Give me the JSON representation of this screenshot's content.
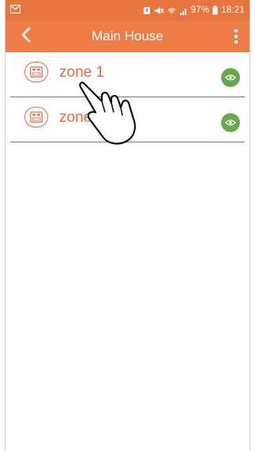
{
  "status_bar": {
    "battery": "97%",
    "time": "18:21",
    "icons": [
      "mail-icon",
      "alarm-icon",
      "mute-icon",
      "wifi-icon",
      "signal-icon",
      "battery-icon"
    ]
  },
  "header": {
    "title": "Main House",
    "back_icon": "chevron-left-icon",
    "menu_icon": "overflow-menu-icon"
  },
  "zones": [
    {
      "label": "zone 1",
      "icon": "thermostat-icon",
      "action_icon": "eye-icon"
    },
    {
      "label": "zone",
      "icon": "thermostat-icon",
      "action_icon": "eye-icon"
    }
  ],
  "overlay": {
    "icon": "pointing-hand-icon"
  },
  "colors": {
    "status_bar": "#e8753f",
    "app_bar": "#ee7c47",
    "zone_text": "#e06a48",
    "eye_button": "#6aa84f",
    "divider": "#7a7a7a"
  }
}
